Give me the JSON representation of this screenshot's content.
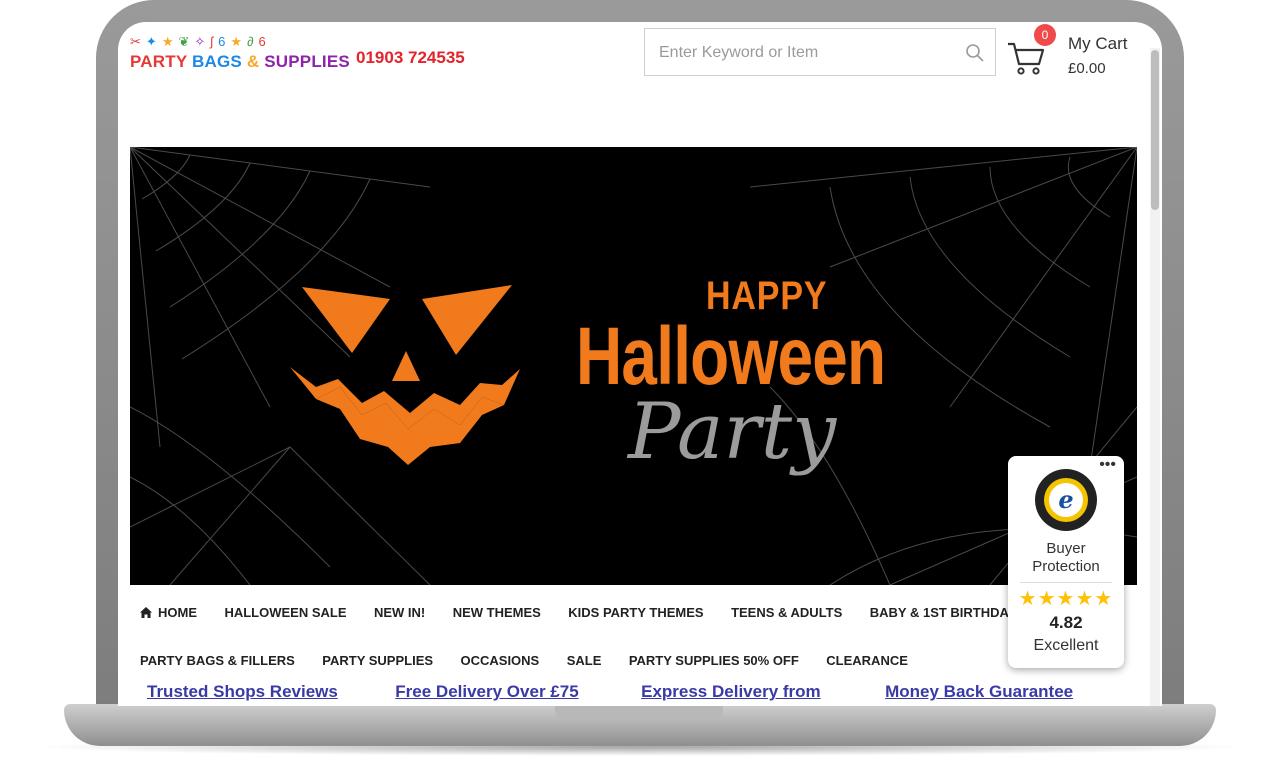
{
  "header": {
    "logo": {
      "text_parts": [
        {
          "text": "PARTY ",
          "color": "#e53935"
        },
        {
          "text": "BAGS ",
          "color": "#1e88e5"
        },
        {
          "text": "& ",
          "color": "#f9a825"
        },
        {
          "text": "SUPPLIES",
          "color": "#8e24aa"
        }
      ]
    },
    "phone": "01903 724535",
    "search": {
      "placeholder": "Enter Keyword or Item"
    },
    "cart": {
      "count": "0",
      "title": "My Cart",
      "total": "£0.00"
    }
  },
  "banner": {
    "happy": "HAPPY",
    "halloween": "Halloween",
    "party": "Party",
    "colors": {
      "orange": "#f07a1c",
      "grey": "#9b9b9b",
      "background": "#000000"
    }
  },
  "nav": {
    "row1": [
      "HOME",
      "HALLOWEEN SALE",
      "NEW IN!",
      "NEW THEMES",
      "KIDS PARTY THEMES",
      "TEENS & ADULTS",
      "BABY & 1ST BIRTHDAY"
    ],
    "row2": [
      "PARTY BAGS & FILLERS",
      "PARTY SUPPLIES",
      "OCCASIONS",
      "SALE",
      "PARTY SUPPLIES 50% OFF",
      "CLEARANCE"
    ]
  },
  "links": [
    "Trusted Shops Reviews",
    "Free Delivery Over £75",
    "Express Delivery from",
    "Money Back Guarantee"
  ],
  "trusted_shops": {
    "menu": "•••",
    "label_line1": "Buyer",
    "label_line2": "Protection",
    "stars": "★★★★★",
    "score": "4.82",
    "rating": "Excellent"
  },
  "colors": {
    "link": "#3a3aa6",
    "phone": "#e2242b",
    "badge": "#ef4b4b",
    "star": "#ffc107"
  }
}
